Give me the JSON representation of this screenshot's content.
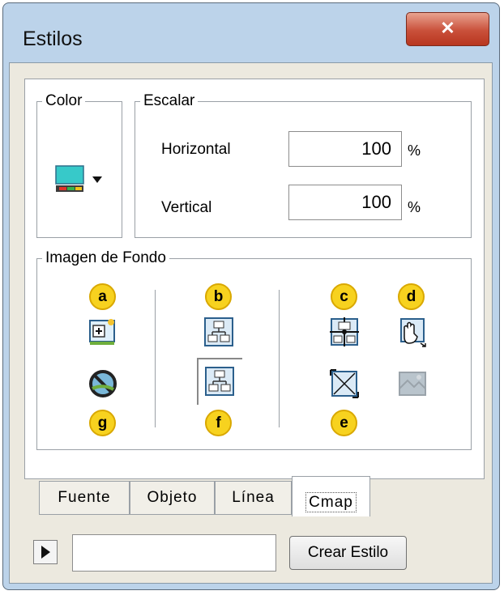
{
  "window": {
    "title": "Estilos",
    "close_glyph": "✕"
  },
  "color_group": {
    "legend": "Color",
    "picker_icon": "color-picker-icon",
    "dropdown_icon": "dropdown-arrow-icon"
  },
  "scale_group": {
    "legend": "Escalar",
    "horizontal": {
      "label": "Horizontal",
      "value": "100",
      "unit": "%"
    },
    "vertical": {
      "label": "Vertical",
      "value": "100",
      "unit": "%"
    }
  },
  "background_group": {
    "legend": "Imagen de Fondo",
    "badges": {
      "a": "a",
      "b": "b",
      "c": "c",
      "d": "d",
      "e": "e",
      "f": "f",
      "g": "g"
    },
    "icons": [
      "add-image-icon",
      "no-image-icon",
      "layout-icon",
      "layout-tiled-icon",
      "center-image-icon",
      "scale-image-icon",
      "fit-image-icon",
      "image-disabled-icon"
    ]
  },
  "tabs": [
    {
      "label": "Fuente",
      "active": false
    },
    {
      "label": "Objeto",
      "active": false
    },
    {
      "label": "Línea",
      "active": false
    },
    {
      "label": "Cmap",
      "active": true
    }
  ],
  "footer": {
    "create_button": "Crear Estilo",
    "style_name_value": ""
  },
  "colors": {
    "badge": "#f7d21f",
    "title_bar": "#bcd3ea",
    "close": "#c9503a"
  }
}
